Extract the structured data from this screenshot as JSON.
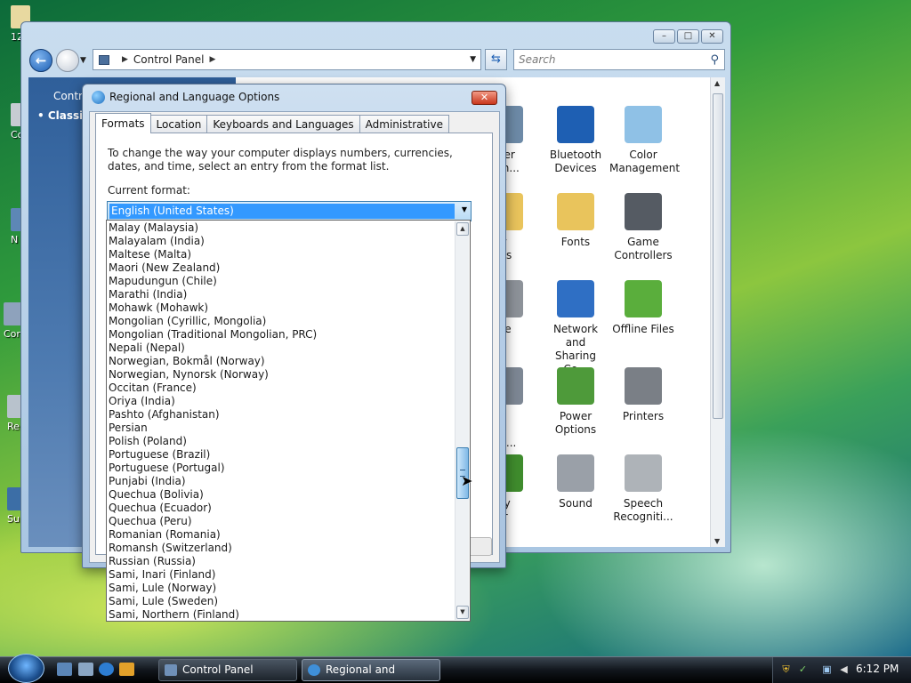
{
  "desktop": {
    "icons": [
      "12",
      "Co",
      "N",
      "Cor",
      "Re",
      "Su"
    ]
  },
  "control_panel": {
    "address": "Control Panel",
    "search_placeholder": "Search",
    "sidebar_title": "Contro",
    "sidebar_classic": "Classic",
    "items": [
      {
        "label": "ocker\ne En...",
        "icon": "bitlocker-icon",
        "color": "#6d8aa7"
      },
      {
        "label": "Bluetooth\nDevices",
        "icon": "bluetooth-icon",
        "color": "#1e5fb3"
      },
      {
        "label": "Color\nManagement",
        "icon": "color-management-icon",
        "color": "#8fc1e6"
      },
      {
        "label": "lder\ntions",
        "icon": "folder-options-icon",
        "color": "#e9c45c"
      },
      {
        "label": "Fonts",
        "icon": "fonts-icon",
        "color": "#e9c45c"
      },
      {
        "label": "Game\nControllers",
        "icon": "game-controller-icon",
        "color": "#555b63"
      },
      {
        "label": "ouse",
        "icon": "mouse-icon",
        "color": "#8d9299"
      },
      {
        "label": "Network and\nSharing Ce...",
        "icon": "network-icon",
        "color": "#2f6fc4"
      },
      {
        "label": "Offline Files",
        "icon": "offline-files-icon",
        "color": "#5aae3c"
      },
      {
        "label": "ne and\nem ...",
        "icon": "phone-modem-icon",
        "color": "#7d8794"
      },
      {
        "label": "Power\nOptions",
        "icon": "power-options-icon",
        "color": "#4e9a3a"
      },
      {
        "label": "Printers",
        "icon": "printer-icon",
        "color": "#7a7f86"
      },
      {
        "label": "urity\nnter",
        "icon": "security-center-icon",
        "color": "#3f8c2d"
      },
      {
        "label": "Sound",
        "icon": "sound-icon",
        "color": "#9aa0a8"
      },
      {
        "label": "Speech\nRecogniti...",
        "icon": "microphone-icon",
        "color": "#aeb3b8"
      }
    ]
  },
  "dialog": {
    "title": "Regional and Language Options",
    "tabs": [
      "Formats",
      "Location",
      "Keyboards and Languages",
      "Administrative"
    ],
    "description": "To change the way your computer displays numbers, currencies, dates, and time, select an entry from the format list.",
    "current_format_label": "Current format:",
    "current_format_value": "English (United States)",
    "options": [
      "Malay (Malaysia)",
      "Malayalam (India)",
      "Maltese (Malta)",
      "Maori (New Zealand)",
      "Mapudungun (Chile)",
      "Marathi (India)",
      "Mohawk (Mohawk)",
      "Mongolian (Cyrillic, Mongolia)",
      "Mongolian (Traditional Mongolian, PRC)",
      "Nepali (Nepal)",
      "Norwegian, Bokmål (Norway)",
      "Norwegian, Nynorsk (Norway)",
      "Occitan (France)",
      "Oriya (India)",
      "Pashto (Afghanistan)",
      "Persian",
      "Polish (Poland)",
      "Portuguese (Brazil)",
      "Portuguese (Portugal)",
      "Punjabi (India)",
      "Quechua (Bolivia)",
      "Quechua (Ecuador)",
      "Quechua (Peru)",
      "Romanian (Romania)",
      "Romansh (Switzerland)",
      "Russian (Russia)",
      "Sami, Inari (Finland)",
      "Sami, Lule (Norway)",
      "Sami, Lule (Sweden)",
      "Sami, Northern (Finland)"
    ]
  },
  "taskbar": {
    "buttons": [
      "Control Panel",
      "Regional and Langu..."
    ],
    "clock": "6:12 PM"
  }
}
